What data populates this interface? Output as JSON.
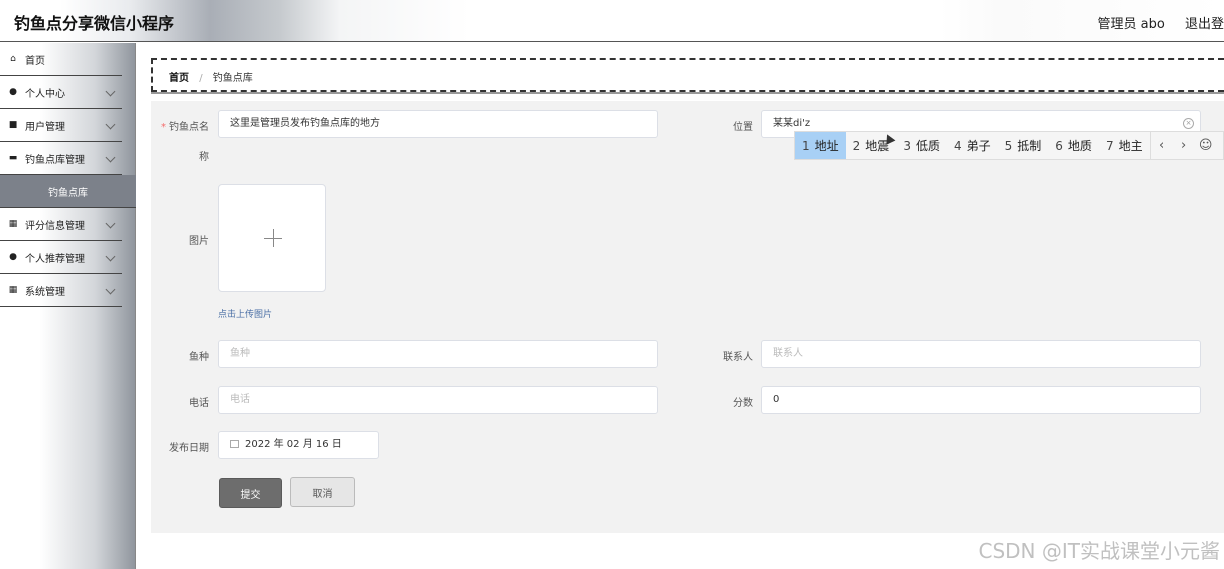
{
  "header": {
    "title": "钓鱼点分享微信小程序",
    "user": "管理员 abo",
    "logout": "退出登"
  },
  "sidebar": {
    "items": [
      {
        "label": "首页",
        "icon": "home-icon"
      },
      {
        "label": "个人中心",
        "icon": "user-icon"
      },
      {
        "label": "用户管理",
        "icon": "user-manage-icon"
      },
      {
        "label": "钓鱼点库管理",
        "icon": "monitor-icon"
      },
      {
        "label": "钓鱼点库",
        "icon": ""
      },
      {
        "label": "评分信息管理",
        "icon": "grid-icon"
      },
      {
        "label": "个人推荐管理",
        "icon": "user-icon"
      },
      {
        "label": "系统管理",
        "icon": "grid-icon"
      }
    ]
  },
  "breadcrumb": {
    "home": "首页",
    "separator": "/",
    "current": "钓鱼点库"
  },
  "form": {
    "name_label": "钓鱼点名",
    "name_label_wrap": "称",
    "name_required": "*",
    "name_value": "这里是管理员发布钓鱼点库的地方",
    "location_label": "位置",
    "location_value": "某某di'z",
    "image_label": "图片",
    "upload_tip": "点击上传图片",
    "fish_label": "鱼种",
    "fish_placeholder": "鱼种",
    "contact_label": "联系人",
    "contact_placeholder": "联系人",
    "phone_label": "电话",
    "phone_placeholder": "电话",
    "score_label": "分数",
    "score_value": "0",
    "date_label": "发布日期",
    "date_value": "2022 年 02 月 16 日",
    "submit": "提交",
    "cancel": "取消"
  },
  "ime": {
    "candidates": [
      {
        "num": "1",
        "text": "地址"
      },
      {
        "num": "2",
        "text": "地震"
      },
      {
        "num": "3",
        "text": "低质"
      },
      {
        "num": "4",
        "text": "弟子"
      },
      {
        "num": "5",
        "text": "抵制"
      },
      {
        "num": "6",
        "text": "地质"
      },
      {
        "num": "7",
        "text": "地主"
      }
    ],
    "prev": "‹",
    "next": "›",
    "emoji": "☺"
  },
  "watermark": "CSDN @IT实战课堂小元酱",
  "colors": {
    "primary_button": "#6d6d6d",
    "sidebar_active": "#7c818a",
    "ime_highlight": "#a8d0f5",
    "required": "#f56c6c"
  }
}
